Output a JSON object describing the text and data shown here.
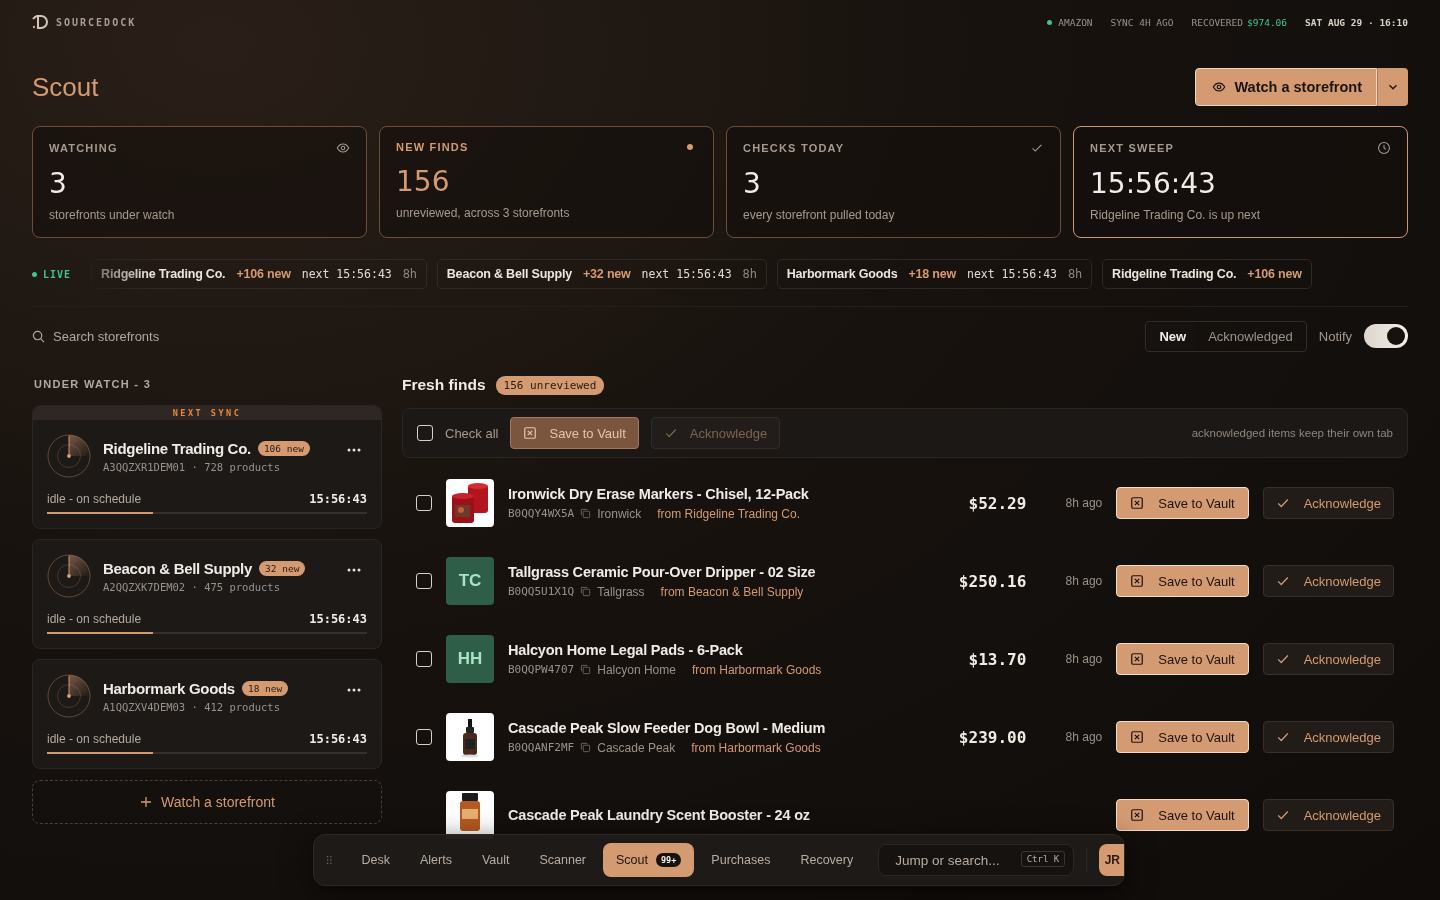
{
  "brand": {
    "name": "SOURCEDOCK"
  },
  "status": {
    "marketplace": "AMAZON",
    "sync": "SYNC 4H AGO",
    "recovered_label": "RECOVERED",
    "recovered_value": "$974.06",
    "datetime": "SAT AUG 29 · 16:10"
  },
  "page": {
    "title": "Scout",
    "primary_action": "Watch a storefront"
  },
  "stats": [
    {
      "label": "WATCHING",
      "value": "3",
      "caption": "storefronts under watch",
      "kind": "eye",
      "accent": false,
      "highlighted": false
    },
    {
      "label": "NEW FINDS",
      "value": "156",
      "caption": "unreviewed, across 3 storefronts",
      "kind": "dot",
      "accent": true,
      "highlighted": false
    },
    {
      "label": "CHECKS TODAY",
      "value": "3",
      "caption": "every storefront pulled today",
      "kind": "check",
      "accent": false,
      "highlighted": false
    },
    {
      "label": "NEXT SWEEP",
      "value": "15:56:43",
      "caption": "Ridgeline Trading Co. is up next",
      "kind": "clock",
      "accent": false,
      "highlighted": true
    }
  ],
  "ticker": {
    "label": "LIVE",
    "items": [
      {
        "name": "Ridgeline Trading Co.",
        "new": "+106 new",
        "next": "next 15:56:43",
        "age": "8h"
      },
      {
        "name": "Beacon & Bell Supply",
        "new": "+32 new",
        "next": "next 15:56:43",
        "age": "8h"
      },
      {
        "name": "Harbormark Goods",
        "new": "+18 new",
        "next": "next 15:56:43",
        "age": "8h"
      },
      {
        "name": "Ridgeline Trading Co.",
        "new": "+106 new"
      }
    ]
  },
  "search": {
    "placeholder": "Search storefronts"
  },
  "view_tabs": [
    {
      "label": "New",
      "selected": true
    },
    {
      "label": "Acknowledged",
      "selected": false
    }
  ],
  "notify": {
    "label": "Notify",
    "on": true
  },
  "watchlist": {
    "heading": "UNDER WATCH - 3",
    "next_sync_label": "NEXT SYNC",
    "add_label": "Watch a storefront",
    "items": [
      {
        "name": "Ridgeline Trading Co.",
        "badge": "106 new",
        "meta": "A3QQZXR1DEM01 · 728 products",
        "status": "idle - on schedule",
        "time": "15:56:43",
        "level": 0.33,
        "next_sync": true
      },
      {
        "name": "Beacon & Bell Supply",
        "badge": "32 new",
        "meta": "A2QQZXK7DEM02 · 475 products",
        "status": "idle - on schedule",
        "time": "15:56:43",
        "level": 0.33,
        "next_sync": false
      },
      {
        "name": "Harbormark Goods",
        "badge": "18 new",
        "meta": "A1QQZXV4DEM03 · 412 products",
        "status": "idle - on schedule",
        "time": "15:56:43",
        "level": 0.33,
        "next_sync": false
      }
    ]
  },
  "finds": {
    "title": "Fresh finds",
    "badge": "156 unreviewed",
    "check_all": {
      "label": "Check all",
      "checked": false
    },
    "bulk_save": "Save to Vault",
    "bulk_ack": "Acknowledge",
    "hint": "acknowledged items keep their own tab",
    "rows": [
      {
        "thumb": {
          "kind": "candles"
        },
        "title": "Ironwick Dry Erase Markers - Chisel, 12-Pack",
        "asin": "B0QQY4WX5A",
        "brand": "Ironwick",
        "source": "from Ridgeline Trading Co.",
        "price": "$52.29",
        "age": "8h ago",
        "checked": false,
        "save": "Save to Vault",
        "ack": "Acknowledge"
      },
      {
        "thumb": {
          "kind": "initials",
          "text": "TC"
        },
        "title": "Tallgrass Ceramic Pour-Over Dripper - 02 Size",
        "asin": "B0QQ5U1X1Q",
        "brand": "Tallgrass",
        "source": "from Beacon & Bell Supply",
        "price": "$250.16",
        "age": "8h ago",
        "checked": false,
        "save": "Save to Vault",
        "ack": "Acknowledge"
      },
      {
        "thumb": {
          "kind": "initials",
          "text": "HH"
        },
        "title": "Halcyon Home Legal Pads - 6-Pack",
        "asin": "B0QQPW4707",
        "brand": "Halcyon Home",
        "source": "from Harbormark Goods",
        "price": "$13.70",
        "age": "8h ago",
        "checked": false,
        "save": "Save to Vault",
        "ack": "Acknowledge"
      },
      {
        "thumb": {
          "kind": "dropper"
        },
        "title": "Cascade Peak Slow Feeder Dog Bowl - Medium",
        "asin": "B0QQANF2MF",
        "brand": "Cascade Peak",
        "source": "from Harbormark Goods",
        "price": "$239.00",
        "age": "8h ago",
        "checked": false,
        "save": "Save to Vault",
        "ack": "Acknowledge"
      },
      {
        "thumb": {
          "kind": "bottle"
        },
        "title": "Cascade Peak Laundry Scent Booster - 24 oz",
        "save": "Save to Vault",
        "ack": "Acknowledge"
      }
    ]
  },
  "dock": {
    "items": [
      {
        "label": "Desk",
        "selected": false
      },
      {
        "label": "Alerts",
        "selected": false
      },
      {
        "label": "Vault",
        "selected": false
      },
      {
        "label": "Scanner",
        "selected": false
      },
      {
        "label": "Scout",
        "selected": true,
        "badge": "99+"
      },
      {
        "label": "Purchases",
        "selected": false
      },
      {
        "label": "Recovery",
        "selected": false
      }
    ],
    "search_placeholder": "Jump or search...",
    "shortcut": "Ctrl K",
    "avatar": "JR"
  }
}
